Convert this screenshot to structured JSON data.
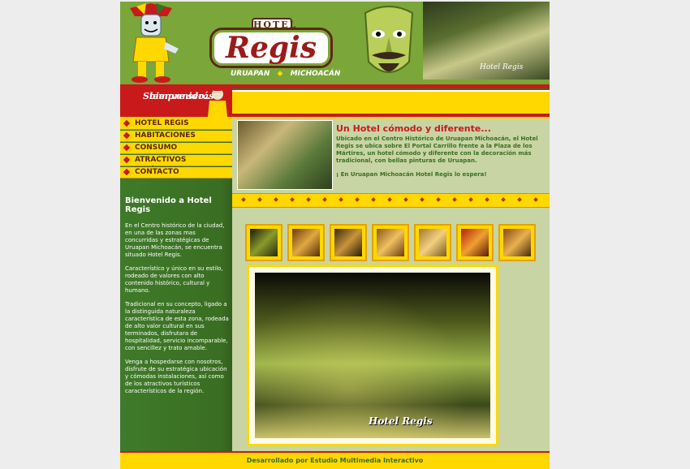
{
  "header": {
    "logo_top": "HOTEL",
    "logo_main": "Regis",
    "logo_sub_left": "URUAPAN",
    "logo_sub_sep": "◆",
    "logo_sub_right": "MICHOACÁN",
    "photo_caption": "Hotel Regis"
  },
  "welcome": {
    "line1": "Siempre serás",
    "line2": "bienvenido.."
  },
  "nav": {
    "items": [
      {
        "label": "HOTEL REGIS"
      },
      {
        "label": "HABITACIONES"
      },
      {
        "label": "CONSUMO"
      },
      {
        "label": "ATRACTIVOS TURÍSTICOS"
      },
      {
        "label": "CONTACTO"
      }
    ]
  },
  "sidebar": {
    "title": "Bienvenido a Hotel Regis",
    "p1": "En el Centro histórico de la ciudad, en una de las zonas mas concurridas y estratégicas de Uruapan Michoacán, se encuentra situado Hotel Regis.",
    "p2": "Característico y único en su estilo, rodeado de valores con alto contenido histórico, cultural y humano.",
    "p3": "Tradicional en su concepto, ligado a la distinguida naturaleza característica de esta zona, rodeada de alto valor cultural en sus terminados, disfrutara de hospitalidad, servicio incomparable, con sencillez y trato amable.",
    "p4": "Venga a hospedarse con nosotros, disfrute de su estratégica ubicación y cómodas instalaciones, así como de los atractivos turísticos característicos de la región."
  },
  "main": {
    "headline": "Un Hotel cómodo y diferente...",
    "body": "Ubicado en el Centro Histórico de Uruapan Michoacán, el Hotel Regis se ubica sobre El Portal Carrillo frente a la Plaza de los Mártires, un hotel cómodo y diferente con la decoración más tradicional, con bellas pinturas de Uruapan.",
    "closing": "¡ En Uruapan Michoacán Hotel Regis lo espera!",
    "big_caption": "Hotel Regis"
  },
  "footer": {
    "text": "Desarrollado por Estudio Multimedia Interactivo"
  },
  "colors": {
    "green": "#7aa63a",
    "dark_green": "#3a6e22",
    "yellow": "#ffd800",
    "red": "#c81a1a",
    "brown": "#5a2a10"
  }
}
